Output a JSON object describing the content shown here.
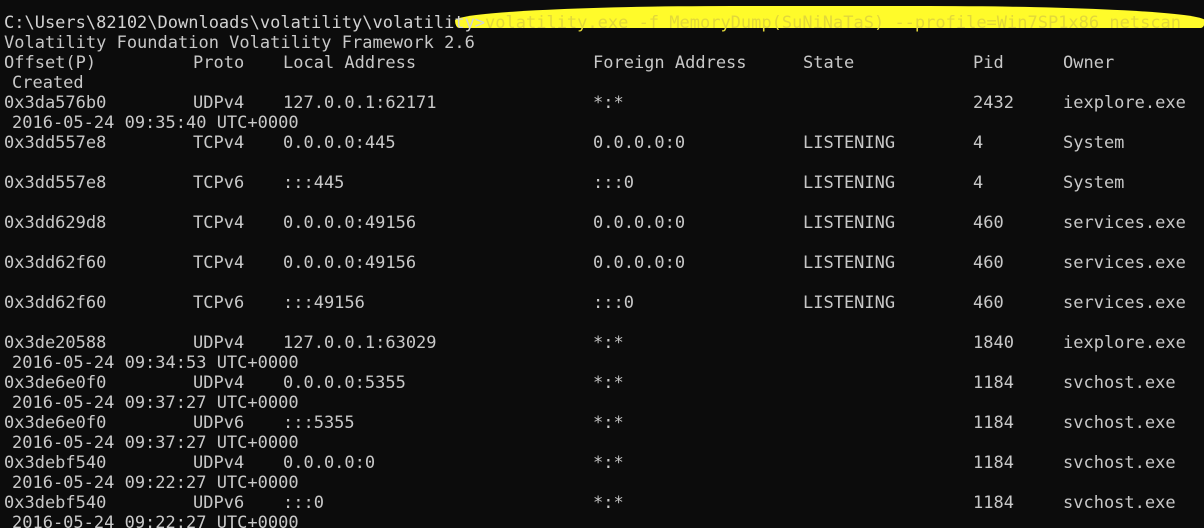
{
  "prompt": "C:\\Users\\82102\\Downloads\\volatility\\volatility>",
  "command": "volatility.exe -f MemoryDump(SuNiNaTaS) --profile=Win7SP1x86 netscan",
  "banner": "Volatility Foundation Volatility Framework 2.6",
  "headers": {
    "offset": "Offset(P)",
    "proto": "Proto",
    "local": "Local Address",
    "foreign": "Foreign Address",
    "state": "State",
    "pid": "Pid",
    "owner": "Owner",
    "created": "Created"
  },
  "rows": [
    {
      "offset": "0x3da576b0",
      "proto": "UDPv4",
      "local": "127.0.0.1:62171",
      "foreign": "*:*",
      "state": "",
      "pid": "2432",
      "owner": "iexplore.exe",
      "created": "2016-05-24 09:35:40 UTC+0000"
    },
    {
      "offset": "0x3dd557e8",
      "proto": "TCPv4",
      "local": "0.0.0.0:445",
      "foreign": "0.0.0.0:0",
      "state": "LISTENING",
      "pid": "4",
      "owner": "System",
      "created": ""
    },
    {
      "offset": "0x3dd557e8",
      "proto": "TCPv6",
      "local": ":::445",
      "foreign": ":::0",
      "state": "LISTENING",
      "pid": "4",
      "owner": "System",
      "created": ""
    },
    {
      "offset": "0x3dd629d8",
      "proto": "TCPv4",
      "local": "0.0.0.0:49156",
      "foreign": "0.0.0.0:0",
      "state": "LISTENING",
      "pid": "460",
      "owner": "services.exe",
      "created": ""
    },
    {
      "offset": "0x3dd62f60",
      "proto": "TCPv4",
      "local": "0.0.0.0:49156",
      "foreign": "0.0.0.0:0",
      "state": "LISTENING",
      "pid": "460",
      "owner": "services.exe",
      "created": ""
    },
    {
      "offset": "0x3dd62f60",
      "proto": "TCPv6",
      "local": ":::49156",
      "foreign": ":::0",
      "state": "LISTENING",
      "pid": "460",
      "owner": "services.exe",
      "created": ""
    },
    {
      "offset": "0x3de20588",
      "proto": "UDPv4",
      "local": "127.0.0.1:63029",
      "foreign": "*:*",
      "state": "",
      "pid": "1840",
      "owner": "iexplore.exe",
      "created": "2016-05-24 09:34:53 UTC+0000"
    },
    {
      "offset": "0x3de6e0f0",
      "proto": "UDPv4",
      "local": "0.0.0.0:5355",
      "foreign": "*:*",
      "state": "",
      "pid": "1184",
      "owner": "svchost.exe",
      "created": "2016-05-24 09:37:27 UTC+0000"
    },
    {
      "offset": "0x3de6e0f0",
      "proto": "UDPv6",
      "local": ":::5355",
      "foreign": "*:*",
      "state": "",
      "pid": "1184",
      "owner": "svchost.exe",
      "created": "2016-05-24 09:37:27 UTC+0000"
    },
    {
      "offset": "0x3debf540",
      "proto": "UDPv4",
      "local": "0.0.0.0:0",
      "foreign": "*:*",
      "state": "",
      "pid": "1184",
      "owner": "svchost.exe",
      "created": "2016-05-24 09:22:27 UTC+0000"
    },
    {
      "offset": "0x3debf540",
      "proto": "UDPv6",
      "local": ":::0",
      "foreign": "*:*",
      "state": "",
      "pid": "1184",
      "owner": "svchost.exe",
      "created": "2016-05-24 09:22:27 UTC+0000"
    }
  ]
}
